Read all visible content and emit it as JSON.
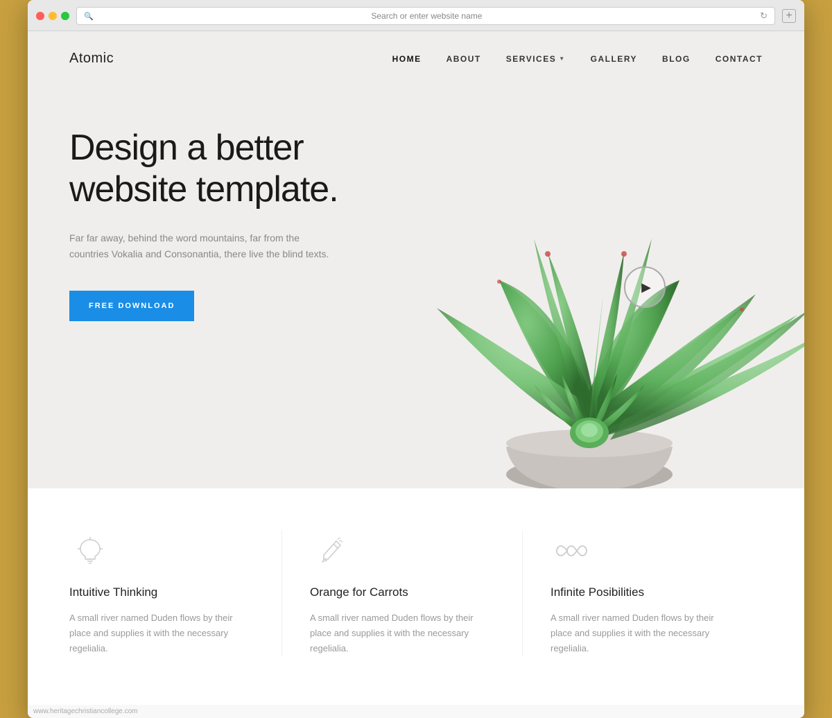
{
  "browser": {
    "address_bar_placeholder": "Search or enter website name",
    "new_tab_label": "+"
  },
  "nav": {
    "logo": "Atomic",
    "links": [
      {
        "label": "HOME",
        "active": true,
        "has_dropdown": false
      },
      {
        "label": "ABOUT",
        "active": false,
        "has_dropdown": false
      },
      {
        "label": "SERVICES",
        "active": false,
        "has_dropdown": true
      },
      {
        "label": "GALLERY",
        "active": false,
        "has_dropdown": false
      },
      {
        "label": "BLOG",
        "active": false,
        "has_dropdown": false
      },
      {
        "label": "CONTACT",
        "active": false,
        "has_dropdown": false
      }
    ]
  },
  "hero": {
    "title": "Design a better website template.",
    "subtitle": "Far far away, behind the word mountains, far from the countries Vokalia and Consonantia, there live the blind texts.",
    "cta_label": "FREE DOWNLOAD"
  },
  "features": [
    {
      "icon": "lightbulb",
      "title": "Intuitive Thinking",
      "description": "A small river named Duden flows by their place and supplies it with the necessary regelialia."
    },
    {
      "icon": "carrot",
      "title": "Orange for Carrots",
      "description": "A small river named Duden flows by their place and supplies it with the necessary regelialia."
    },
    {
      "icon": "infinity",
      "title": "Infinite Posibilities",
      "description": "A small river named Duden flows by their place and supplies it with the necessary regelialia."
    }
  ],
  "watermark": "www.heritagechristiancollege.com",
  "colors": {
    "accent_blue": "#1a8ee6",
    "text_dark": "#1a1a1a",
    "text_light": "#888",
    "bg_hero": "#f0eeec",
    "bg_white": "#ffffff"
  }
}
